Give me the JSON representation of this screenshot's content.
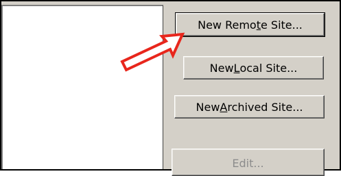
{
  "site_manager": {
    "buttons": {
      "new_remote": {
        "before": "New Remo",
        "mnemonic": "t",
        "after": "e Site..."
      },
      "new_local": {
        "before": "New ",
        "mnemonic": "L",
        "after": "ocal Site..."
      },
      "new_archived": {
        "before": "New ",
        "mnemonic": "A",
        "after": "rchived Site..."
      },
      "edit": {
        "label": "Edit..."
      }
    },
    "annotation": {
      "arrow_color": "#e8261c",
      "icon": "arrow-pointer-icon"
    }
  }
}
